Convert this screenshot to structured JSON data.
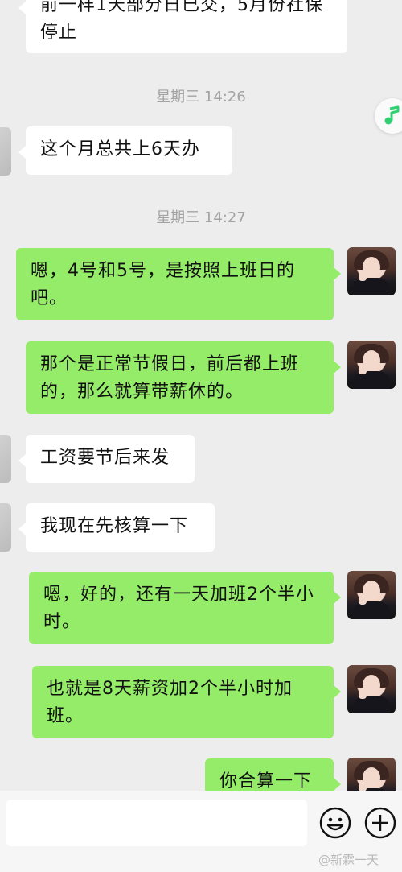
{
  "messages": {
    "m1": "前一样1天部分日已交，5月份社保停止",
    "m2": "这个月总共上6天办",
    "m3": "嗯，4号和5号，是按照上班日的吧。",
    "m4": "那个是正常节假日，前后都上班的，那么就算带薪休的。",
    "m5": "工资要节后来发",
    "m6": "我现在先核算一下",
    "m7": "嗯，好的，还有一天加班2个半小时。",
    "m8": "也就是8天薪资加2个半小时加班。",
    "m9": "你合算一下"
  },
  "timestamps": {
    "t1": "星期三 14:26",
    "t2": "星期三 14:27"
  },
  "input": {
    "placeholder": ""
  },
  "icons": {
    "emoji": "emoji-icon",
    "plus": "plus-icon",
    "music": "music-note-icon"
  },
  "watermark": "@新霖一天",
  "colors": {
    "outgoing_bubble": "#95ec69",
    "incoming_bubble": "#ffffff",
    "background": "#ededed",
    "music_note": "#2fd072"
  }
}
